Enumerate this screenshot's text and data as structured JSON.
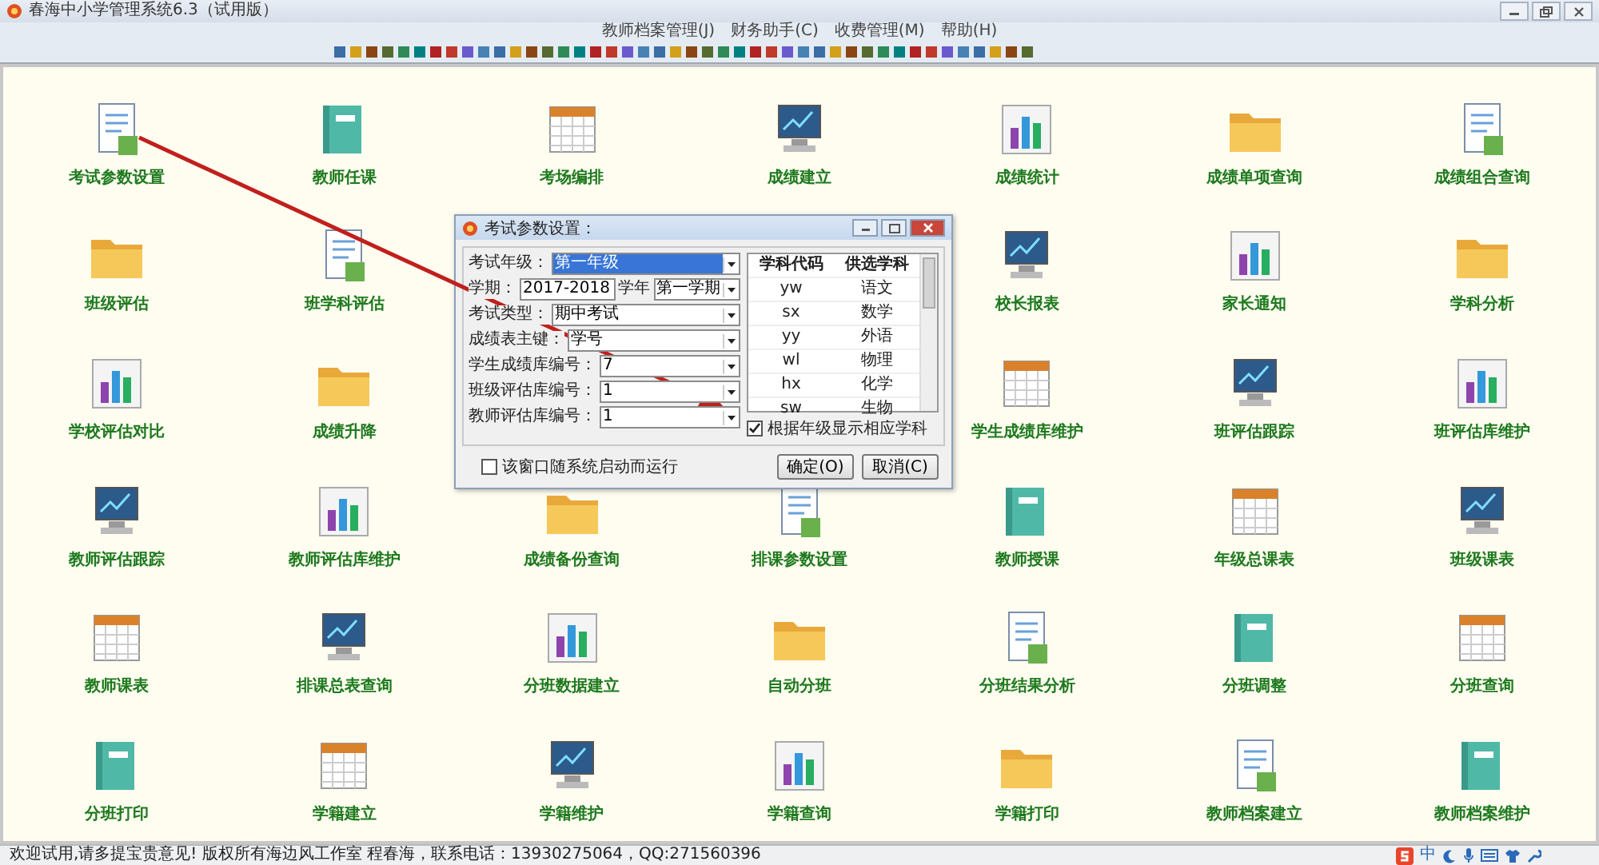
{
  "window": {
    "title": "春海中小学管理系统6.3（试用版）"
  },
  "menu": [
    "教师档案管理(J)",
    "财务助手(C)",
    "收费管理(M)",
    "帮助(H)"
  ],
  "grid": {
    "rows": [
      [
        {
          "label": "考试参数设置"
        },
        {
          "label": "教师任课"
        },
        {
          "label": "考场编排"
        },
        {
          "label": "成绩建立"
        },
        {
          "label": "成绩统计"
        },
        {
          "label": "成绩单项查询"
        },
        {
          "label": "成绩组合查询"
        }
      ],
      [
        {
          "label": "班级评估"
        },
        {
          "label": "班学科评估"
        },
        null,
        null,
        {
          "label": "校长报表"
        },
        {
          "label": "家长通知"
        },
        {
          "label": "学科分析"
        }
      ],
      [
        {
          "label": "学校评估对比"
        },
        {
          "label": "成绩升降"
        },
        null,
        null,
        {
          "label": "学生成绩库维护"
        },
        {
          "label": "班评估跟踪"
        },
        {
          "label": "班评估库维护"
        }
      ],
      [
        {
          "label": "教师评估跟踪"
        },
        {
          "label": "教师评估库维护"
        },
        {
          "label": "成绩备份查询"
        },
        {
          "label": "排课参数设置"
        },
        {
          "label": "教师授课"
        },
        {
          "label": "年级总课表"
        },
        {
          "label": "班级课表"
        }
      ],
      [
        {
          "label": "教师课表"
        },
        {
          "label": "排课总表查询"
        },
        {
          "label": "分班数据建立"
        },
        {
          "label": "自动分班"
        },
        {
          "label": "分班结果分析"
        },
        {
          "label": "分班调整"
        },
        {
          "label": "分班查询"
        }
      ],
      [
        {
          "label": "分班打印"
        },
        {
          "label": "学籍建立"
        },
        {
          "label": "学籍维护"
        },
        {
          "label": "学籍查询"
        },
        {
          "label": "学籍打印"
        },
        {
          "label": "教师档案建立"
        },
        {
          "label": "教师档案维护"
        }
      ]
    ]
  },
  "dialog": {
    "title": "考试参数设置：",
    "fields": [
      {
        "kind": "select",
        "label": "考试年级：",
        "value": "第一年级",
        "focused": true
      },
      {
        "kind": "term",
        "label": "学期：",
        "value": "2017-2018",
        "unit": "学年",
        "term": "第一学期",
        "focused": false
      },
      {
        "kind": "select",
        "label": "考试类型：",
        "value": "期中考试",
        "focused": false
      },
      {
        "kind": "select",
        "label": "成绩表主键：",
        "value": "学号",
        "focused": false
      },
      {
        "kind": "select",
        "label": "学生成绩库编号：",
        "value": "7",
        "focused": false
      },
      {
        "kind": "select",
        "label": "班级评估库编号：",
        "value": "1",
        "focused": false
      },
      {
        "kind": "select",
        "label": "教师评估库编号：",
        "value": "1",
        "focused": false
      }
    ],
    "subjects": {
      "columns": [
        "学科代码",
        "供选学科"
      ],
      "rows": [
        [
          "yw",
          "语文"
        ],
        [
          "sx",
          "数学"
        ],
        [
          "yy",
          "外语"
        ],
        [
          "wl",
          "物理"
        ],
        [
          "hx",
          "化学"
        ],
        [
          "sw",
          "生物"
        ]
      ]
    },
    "filter_checkbox": {
      "label": "根据年级显示相应学科",
      "checked": true
    },
    "startup_checkbox": {
      "label": "该窗口随系统启动而运行",
      "checked": false
    },
    "buttons": [
      "确定(O)",
      "取消(C)"
    ]
  },
  "status_bar": {
    "text": "欢迎试用,请多提宝贵意见! 版权所有海边风工作室 程春海，联系电话：13930275064，QQ:271560396",
    "ime_label": "中"
  }
}
